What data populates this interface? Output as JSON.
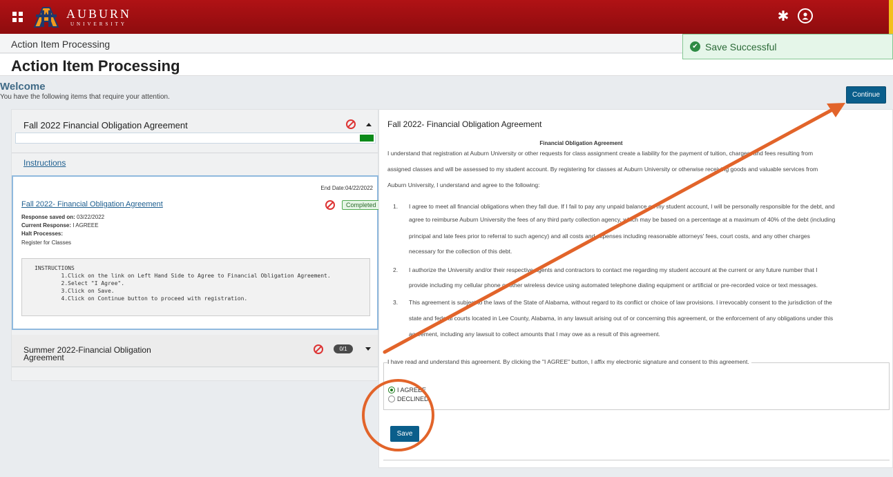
{
  "header": {
    "logo_line1": "AUBURN",
    "logo_line2": "UNIVERSITY"
  },
  "breadcrumb": "Action Item Processing",
  "page_title": "Action Item Processing",
  "toast": {
    "text": "Save Successful",
    "color": "#2e8b44"
  },
  "welcome": {
    "heading": "Welcome",
    "subtext": "You have the following items that require your attention."
  },
  "continue_label": "Continue",
  "left_panel": {
    "group1_title": "Fall 2022 Financial Obligation Agreement",
    "progress": 1.0,
    "instructions_link": "Instructions",
    "card": {
      "end_date": "End Date:04/22/2022",
      "title": "Fall 2022- Financial Obligation Agreement",
      "status": "Completed",
      "saved_label": "Response saved on:",
      "saved_value": "03/22/2022",
      "current_label": "Current Response:",
      "current_value": "I AGREEE",
      "halt_label": "Halt Processes:",
      "halt_value": "Register for Classes",
      "instructions_text": "INSTRUCTIONS\n        1.Click on the link on Left Hand Side to Agree to Financial Obligation Agreement.\n        2.Select \"I Agree\".\n        3.Click on Save.\n        4.Click on Continue button to proceed with registration."
    },
    "group2_title": "Summer 2022-Financial Obligation Agreement",
    "group2_count": "0/1"
  },
  "right_panel": {
    "title": "Fall 2022- Financial Obligation Agreement",
    "heading": "Financial Obligation Agreement",
    "intro_lines": [
      "I understand that registration at Auburn University or other requests for class assignment create a liability for the payment of tuition, charges, and fees resulting from",
      "assigned classes and will be assessed to my student account. By registering for classes at Auburn University or otherwise receiving goods and valuable services from",
      "Auburn University, I understand and agree to the following:"
    ],
    "items": [
      {
        "num": "1.",
        "lines": [
          "I agree to meet all financial obligations when they fall due. If I fail to pay any unpaid balance on my student account, I will be personally responsible for the debt, and",
          "agree to reimburse Auburn University the fees of any third party collection agency, which may be based on a percentage at a maximum of 40% of the debt (including",
          "principal and late fees prior to referral to such agency) and all costs and expenses including reasonable attorneys' fees, court costs, and any other charges",
          "necessary for the collection of this debt."
        ]
      },
      {
        "num": "2.",
        "lines": [
          "I authorize the University and/or their respective agents and contractors to contact me regarding my student account at the current or any future number that I",
          "provide including my cellular phone or other wireless device using automated telephone dialing equipment or artificial or pre-recorded voice or text messages."
        ]
      },
      {
        "num": "3.",
        "lines": [
          "This agreement is subject to the laws of the State of Alabama, without regard to its conflict or choice of law provisions. I irrevocably consent to the jurisdiction of the",
          "state and federal courts located in Lee County, Alabama, in any lawsuit arising out of or concerning this agreement, or the enforcement of any obligations under this",
          "agreement, including any lawsuit to collect amounts that I may owe as a result of this agreement."
        ]
      }
    ],
    "consent_text": "I have read and understand this agreement. By clicking the \"I AGREE\" button, I affix my electronic signature and consent to this agreement.",
    "option_agree": "I AGREEE",
    "option_decline": "DECLINED",
    "selected": "I AGREEE",
    "save_label": "Save"
  },
  "colors": {
    "brand": "#a01013",
    "button": "#0a5e8b",
    "annotation": "#e2642a",
    "accent_gold": "#f3c01b"
  }
}
